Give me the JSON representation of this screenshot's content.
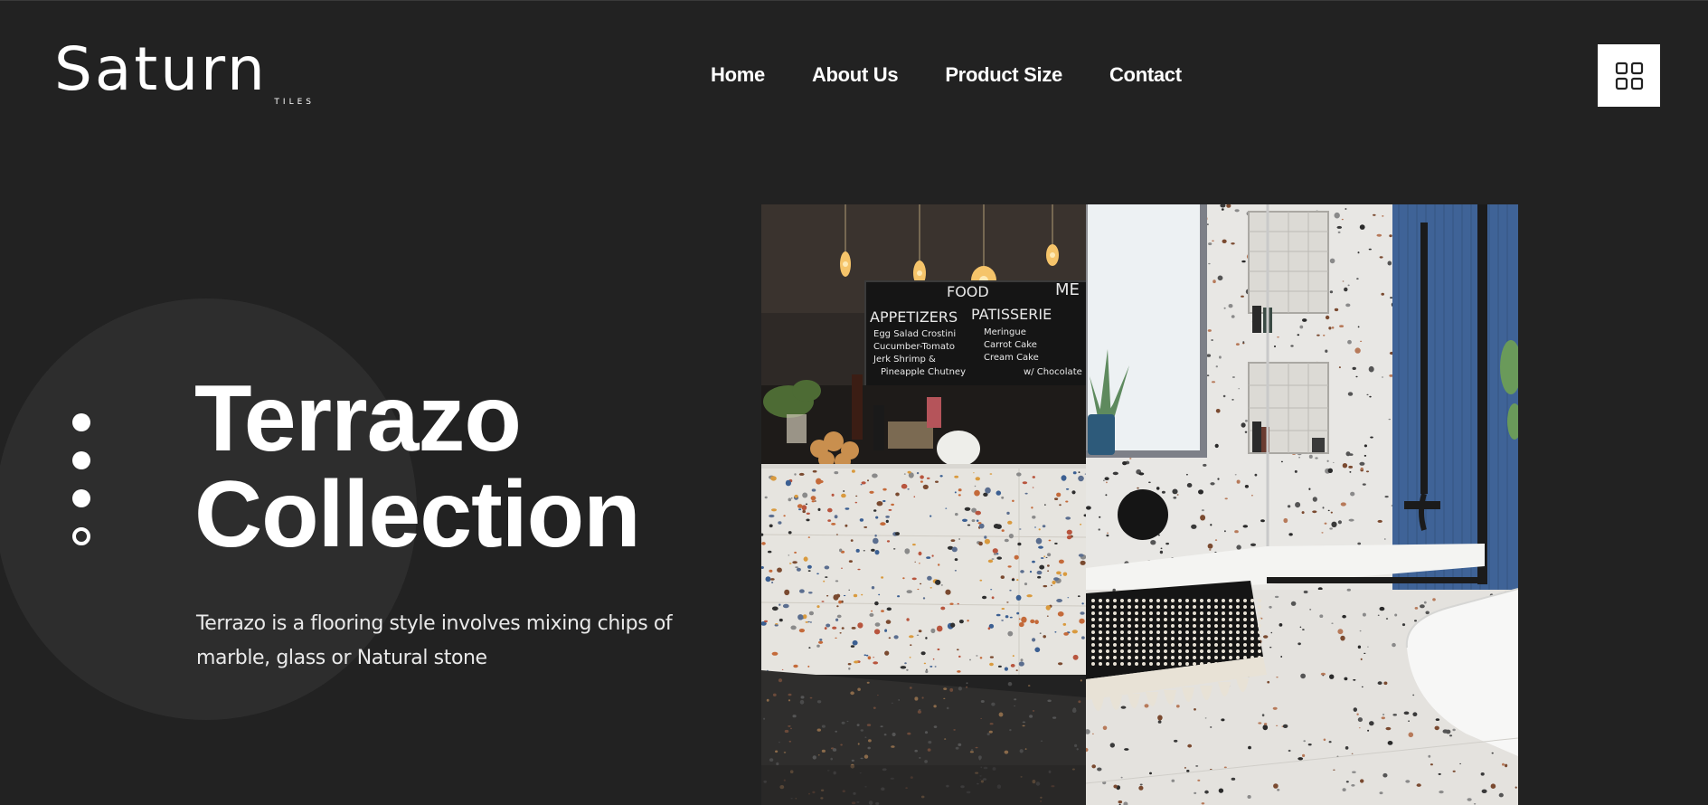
{
  "brand": {
    "name": "Saturn",
    "tagline": "TILES"
  },
  "nav": {
    "items": [
      {
        "label": "Home"
      },
      {
        "label": "About Us"
      },
      {
        "label": "Product Size"
      },
      {
        "label": "Contact"
      }
    ]
  },
  "menu_button": {
    "icon": "grid-icon"
  },
  "hero": {
    "title_line1": "Terrazo",
    "title_line2": "Collection",
    "description": "Terrazo is a flooring style involves mixing chips of marble, glass or Natural stone",
    "slider": {
      "count": 4,
      "active_index": 3
    }
  },
  "images": {
    "left": {
      "chalkboard": {
        "heading_left": "APPETIZERS",
        "heading_right": "PATISSERIE",
        "top_text": "FOOD",
        "top_right": "ME",
        "items_left": [
          "Egg Salad Crostini",
          "Cucumber-Tomato",
          "Jerk Shrimp &",
          "Pineapple Chutney"
        ],
        "items_right": [
          "Meringue",
          "Carrot Cake",
          "Cream Cake",
          "w/ Chocolate"
        ]
      }
    }
  },
  "colors": {
    "background": "#222222",
    "circle": "#2d2d2d",
    "text": "#ffffff",
    "tile_blue": "#3b5f92"
  }
}
